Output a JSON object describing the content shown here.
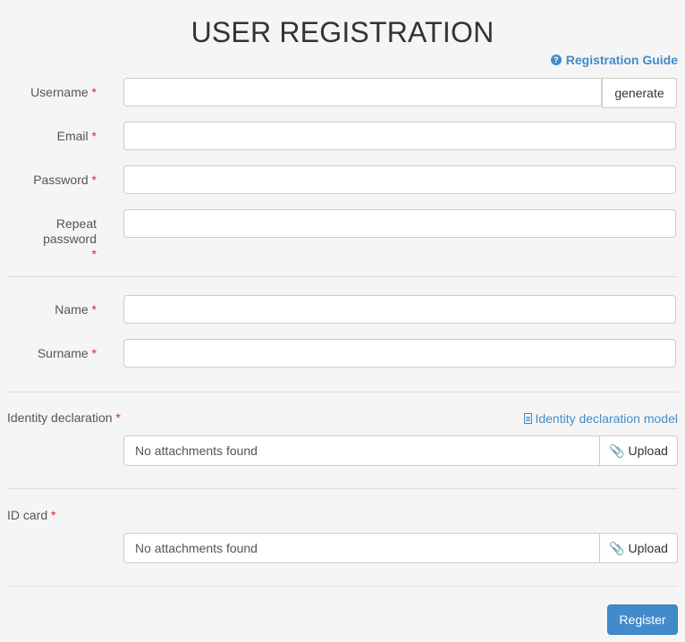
{
  "page": {
    "title": "USER REGISTRATION",
    "guide_link": {
      "icon": "question-circle-icon",
      "label": "Registration Guide"
    }
  },
  "account": {
    "username": {
      "label": "Username",
      "required": "*",
      "value": "",
      "generate_label": "generate"
    },
    "email": {
      "label": "Email",
      "required": "*",
      "value": ""
    },
    "password": {
      "label": "Password",
      "required": "*",
      "value": ""
    },
    "repeat_password": {
      "label": "Repeat password",
      "required": "*",
      "value": ""
    }
  },
  "personal": {
    "name": {
      "label": "Name",
      "required": "*",
      "value": ""
    },
    "surname": {
      "label": "Surname",
      "required": "*",
      "value": ""
    }
  },
  "identity_declaration": {
    "label": "Identity declaration",
    "required": "*",
    "model_link": {
      "icon": "document-icon",
      "label": "Identity declaration model"
    },
    "attachments_text": "No attachments found",
    "upload": {
      "icon": "paperclip-icon",
      "label": "Upload"
    }
  },
  "id_card": {
    "label": "ID card",
    "required": "*",
    "attachments_text": "No attachments found",
    "upload": {
      "icon": "paperclip-icon",
      "label": "Upload"
    }
  },
  "actions": {
    "register_label": "Register"
  },
  "colors": {
    "accent": "#428bca",
    "required": "#d9262c",
    "background": "#f5f5f5"
  }
}
